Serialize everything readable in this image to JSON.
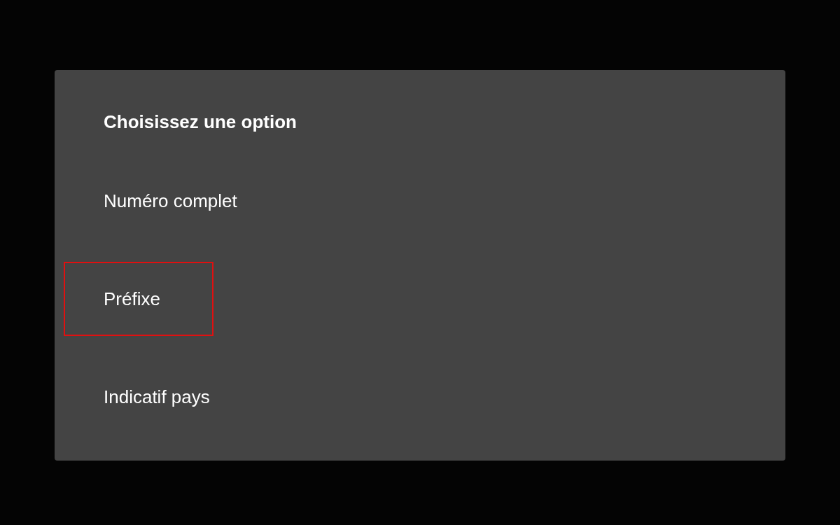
{
  "dialog": {
    "title": "Choisissez une option",
    "options": [
      {
        "label": "Numéro complet",
        "highlighted": false
      },
      {
        "label": "Préfixe",
        "highlighted": true
      },
      {
        "label": "Indicatif pays",
        "highlighted": false
      }
    ]
  }
}
